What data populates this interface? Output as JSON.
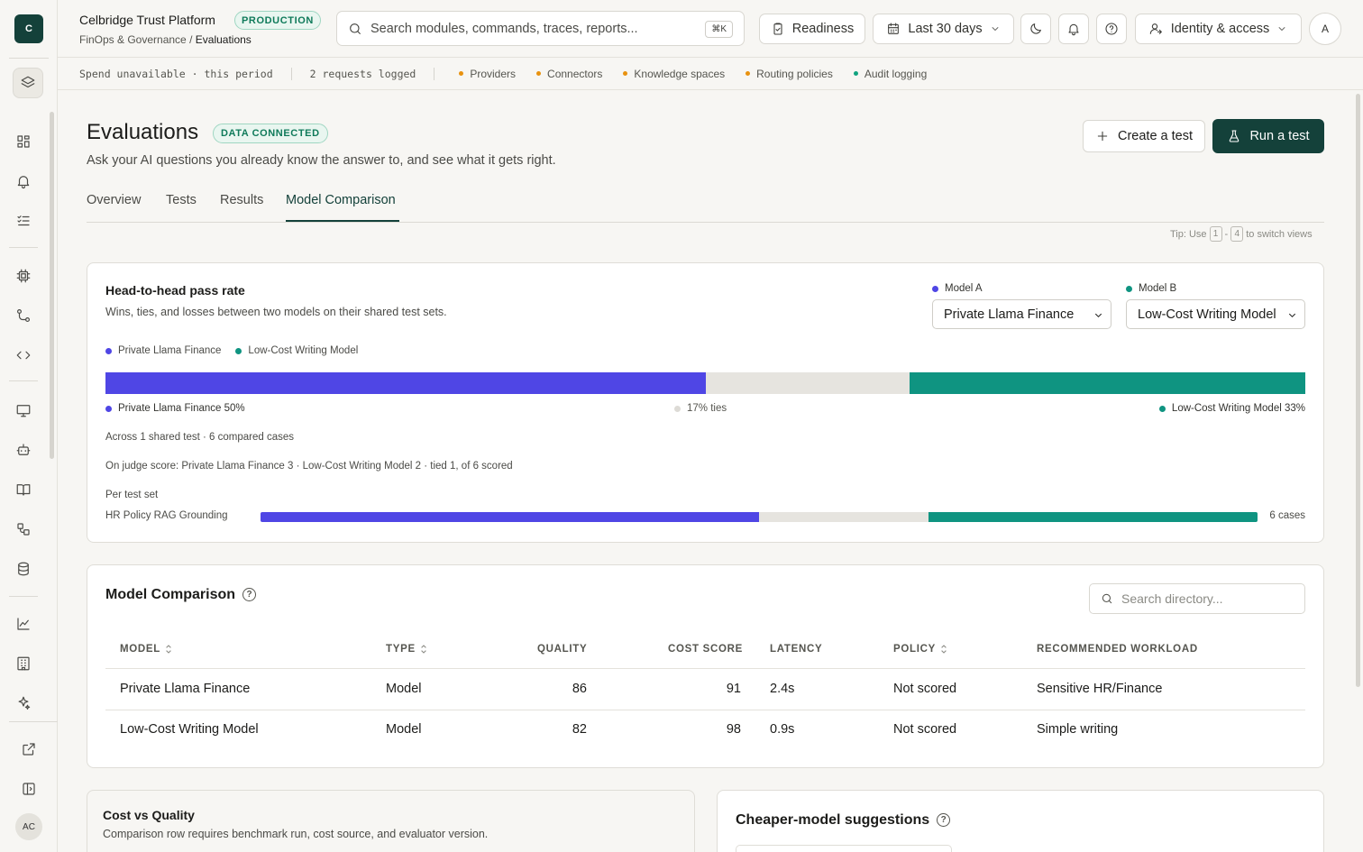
{
  "app": {
    "logo_letter": "C",
    "title": "Celbridge Trust Platform",
    "env_badge": "PRODUCTION",
    "breadcrumb_parent": "FinOps & Governance",
    "breadcrumb_sep": "/",
    "breadcrumb_current": "Evaluations",
    "user_initial": "A",
    "sidebar_user_initials": "AC"
  },
  "header": {
    "search_placeholder": "Search modules, commands, traces, reports...",
    "search_shortcut": "⌘K",
    "readiness_label": "Readiness",
    "date_range_label": "Last 30 days",
    "identity_label": "Identity & access"
  },
  "status_strip": {
    "spend_text": "Spend unavailable · this period",
    "requests_text": "2 requests logged",
    "pills": [
      {
        "label": "Providers",
        "color": "#e8920f"
      },
      {
        "label": "Connectors",
        "color": "#e8920f"
      },
      {
        "label": "Knowledge spaces",
        "color": "#e8920f"
      },
      {
        "label": "Routing policies",
        "color": "#e8920f"
      },
      {
        "label": "Audit logging",
        "color": "#10a37f"
      }
    ]
  },
  "page": {
    "title": "Evaluations",
    "data_badge": "DATA CONNECTED",
    "subtitle": "Ask your AI questions you already know the answer to, and see what it gets right.",
    "create_button": "Create a test",
    "run_button": "Run a test",
    "tabs": [
      "Overview",
      "Tests",
      "Results",
      "Model Comparison"
    ],
    "active_tab": "Model Comparison",
    "tip_prefix": "Tip: Use",
    "tip_key_1": "1",
    "tip_dash": "-",
    "tip_key_2": "4",
    "tip_suffix": "to switch views"
  },
  "head_to_head": {
    "title": "Head-to-head pass rate",
    "subtitle": "Wins, ties, and losses between two models on their shared test sets.",
    "model_a_label": "Model A",
    "model_b_label": "Model B",
    "model_a": "Private Llama Finance",
    "model_b": "Low-Cost Writing Model",
    "color_a": "#4f46e5",
    "color_b": "#0f9481",
    "color_tie": "#e6e4df",
    "win_a_pct": 50,
    "tie_pct": 17,
    "win_b_pct": 33,
    "stat_a": "Private Llama Finance 50%",
    "stat_tie": "17% ties",
    "stat_b": "Low-Cost Writing Model 33%",
    "shared_text": "Across 1 shared test · 6 compared cases",
    "judge_text": "On judge score: Private Llama Finance 3 · Low-Cost Writing Model 2 · tied 1, of 6 scored",
    "per_test_label": "Per test set",
    "per_test": [
      {
        "name": "HR Policy RAG Grounding",
        "a_pct": 50,
        "tie_pct": 17,
        "b_pct": 33,
        "cases": "6 cases"
      }
    ]
  },
  "comparison": {
    "title": "Model Comparison",
    "search_placeholder": "Search directory...",
    "columns": [
      "MODEL",
      "TYPE",
      "QUALITY",
      "COST SCORE",
      "LATENCY",
      "POLICY",
      "RECOMMENDED WORKLOAD"
    ],
    "rows": [
      {
        "model": "Private Llama Finance",
        "type": "Model",
        "quality": "86",
        "cost": "91",
        "latency": "2.4s",
        "policy": "Not scored",
        "workload": "Sensitive HR/Finance"
      },
      {
        "model": "Low-Cost Writing Model",
        "type": "Model",
        "quality": "82",
        "cost": "98",
        "latency": "0.9s",
        "policy": "Not scored",
        "workload": "Simple writing"
      }
    ]
  },
  "cost_quality": {
    "title": "Cost vs Quality",
    "subtitle": "Comparison row requires benchmark run, cost source, and evaluator version."
  },
  "suggestions": {
    "title": "Cheaper-model suggestions"
  }
}
